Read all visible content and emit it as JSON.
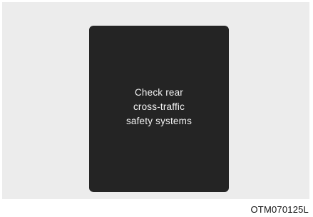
{
  "display": {
    "message_lines": [
      "Check rear",
      "cross-traffic",
      "safety systems"
    ]
  },
  "figure_code": "OTM070125L",
  "colors": {
    "figure_background": "#ececec",
    "screen_background": "#242424",
    "message_text": "#f2f2f2"
  }
}
